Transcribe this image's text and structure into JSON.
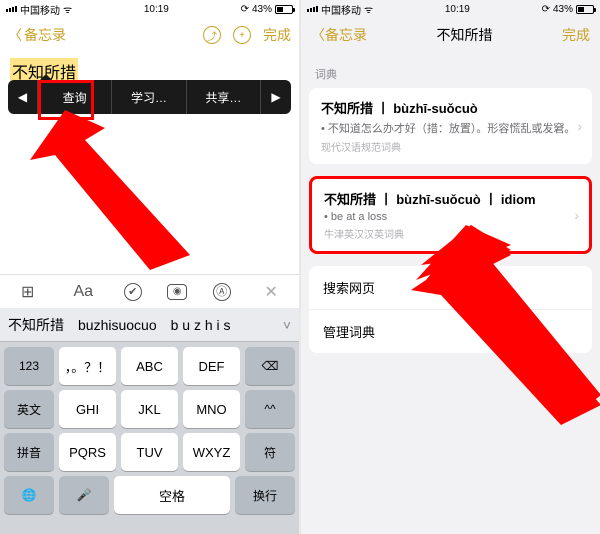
{
  "status": {
    "carrier": "中国移动",
    "time": "10:19",
    "battery": "43%"
  },
  "left": {
    "back_label": "备忘录",
    "done": "完成",
    "selected_text": "不知所措",
    "callout": {
      "prev": "◀",
      "lookup": "查询",
      "learn": "学习…",
      "share": "共享…",
      "next": "▶"
    },
    "toolbar_icons": {
      "table": "⊞",
      "format": "Aa",
      "check": "✔",
      "camera": "◉",
      "markup": "Ⓐ",
      "close": "✕"
    },
    "candidates": {
      "c1": "不知所措",
      "c2": "buzhisuocuo",
      "c3": "b u z h i s",
      "caret": "˅"
    },
    "keys": {
      "r1": {
        "k1": "123",
        "k2": "，。？！",
        "k3": "ABC",
        "k4": "DEF",
        "del": "⌫"
      },
      "r2": {
        "k1": "英文",
        "k2": "GHI",
        "k3": "JKL",
        "k4": "MNO",
        "clr": "^^"
      },
      "r3": {
        "k1": "拼音",
        "k2": "PQRS",
        "k3": "TUV",
        "k4": "WXYZ",
        "sym": "符"
      },
      "r4": {
        "globe": "🌐",
        "mic": "🎤",
        "space": "空格",
        "enter": "换行"
      }
    }
  },
  "right": {
    "back_label": "备忘录",
    "title": "不知所措",
    "done": "完成",
    "section": "词典",
    "entry1": {
      "title": "不知所措 丨 bùzhī-suǒcuò",
      "sub": "• 不知道怎么办才好（措：放置）。形容慌乱或发窘。",
      "src": "现代汉语规范词典"
    },
    "entry2": {
      "title": "不知所措 丨 bùzhī-suǒcuò 丨 idiom",
      "sub": "• be at a loss",
      "src": "牛津英汉汉英词典"
    },
    "search_web": "搜索网页",
    "manage_dict": "管理词典"
  }
}
